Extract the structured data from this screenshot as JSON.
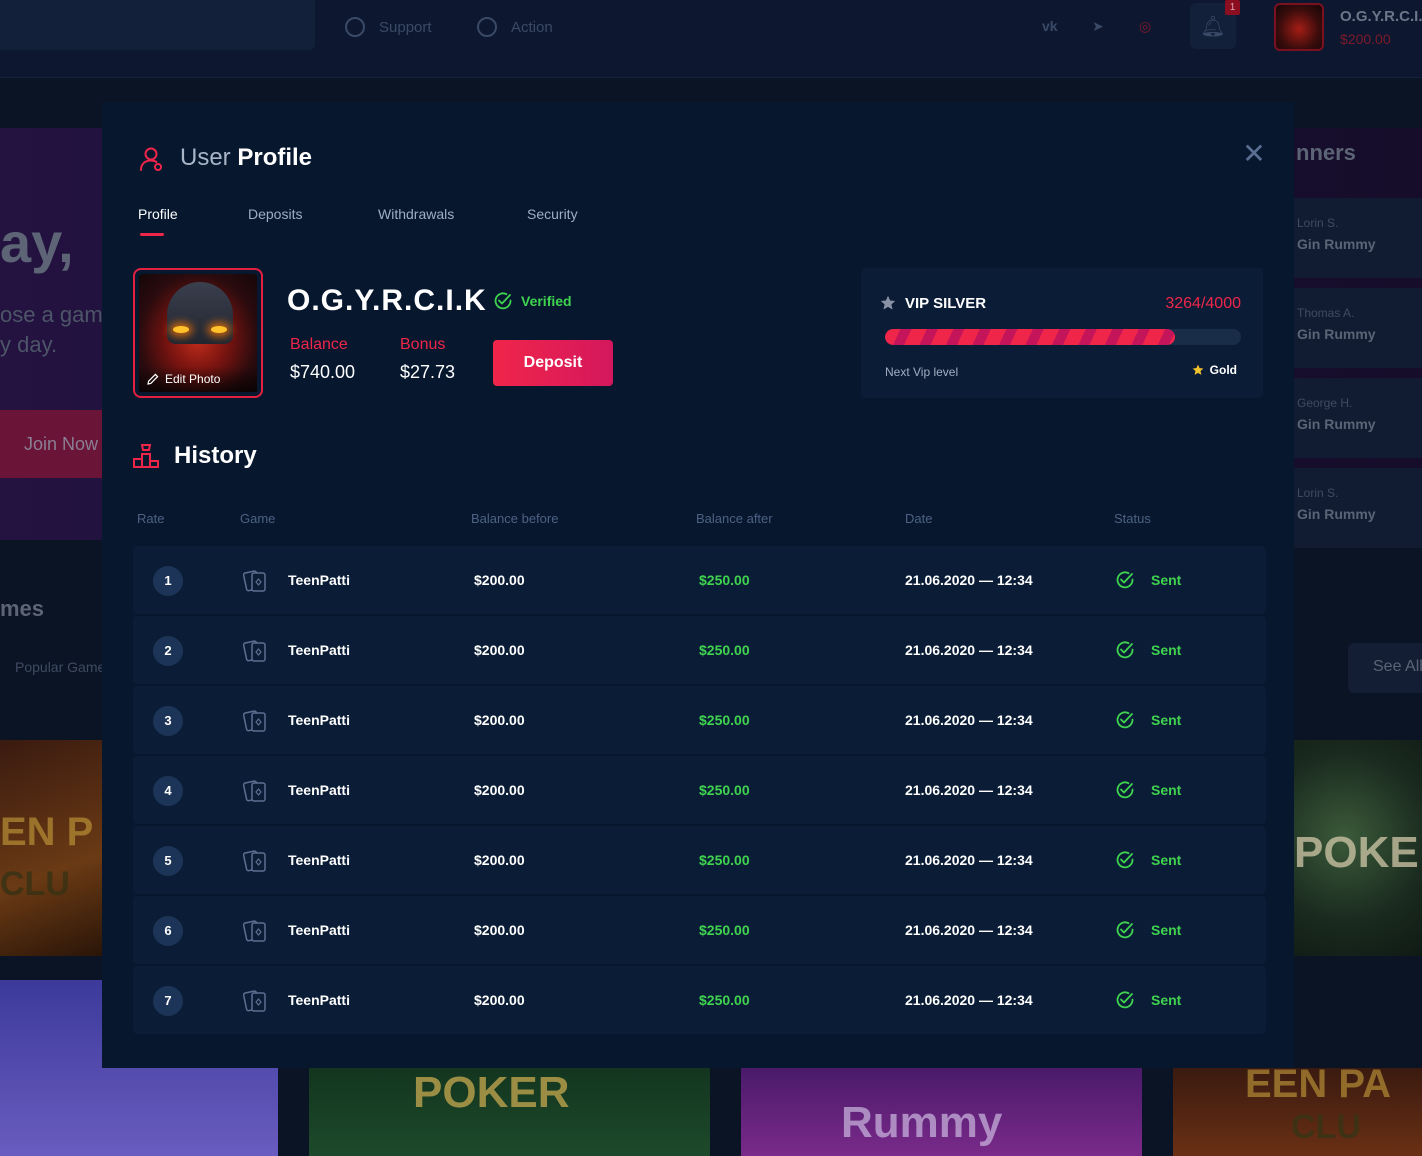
{
  "background": {
    "nav": {
      "support_label": "Support",
      "action_label": "Action",
      "social": [
        {
          "icon": "vk-icon",
          "glyph": "vk",
          "color": "#3a4966"
        },
        {
          "icon": "telegram-icon",
          "glyph": "➤",
          "color": "#3a4966"
        },
        {
          "icon": "instagram-icon",
          "glyph": "◎",
          "color": "#7e1a2a"
        }
      ],
      "notification_count": "1",
      "username": "O.G.Y.R.C.I.K",
      "balance": "$200.00"
    },
    "hero": {
      "title_fragment": "ay, ",
      "subtitle_line1": "ose a gam",
      "subtitle_line2": "y day.",
      "join_label": "Join Now"
    },
    "winners": {
      "title_fragment": "nners",
      "items": [
        {
          "name": "Lorin S.",
          "game": "Gin Rummy"
        },
        {
          "name": "Thomas A.",
          "game": "Gin Rummy"
        },
        {
          "name": "George H.",
          "game": "Gin Rummy"
        },
        {
          "name": "Lorin S.",
          "game": "Gin Rummy"
        }
      ]
    },
    "games": {
      "title_fragment": "mes",
      "filter_fragment": "Popular Game",
      "see_all_label": "See All",
      "tiles": [
        "EN P",
        "CLU",
        "POKE",
        "POKER",
        "Rummy",
        "EEN PA",
        "CLU"
      ]
    }
  },
  "modal": {
    "title_light": "User ",
    "title_bold": "Profile",
    "tabs": [
      {
        "label": "Profile",
        "active": true
      },
      {
        "label": "Deposits",
        "active": false
      },
      {
        "label": "Withdrawals",
        "active": false
      },
      {
        "label": "Security",
        "active": false
      }
    ],
    "profile": {
      "edit_photo_label": "Edit Photo",
      "username": "O.G.Y.R.C.I.K",
      "verified_label": "Verified",
      "balance_label": "Balance",
      "balance_value": "$740.00",
      "bonus_label": "Bonus",
      "bonus_value": "$27.73",
      "deposit_label": "Deposit"
    },
    "vip": {
      "title": "VIP SILVER",
      "score_text": "3264/4000",
      "progress_current": 3264,
      "progress_max": 4000,
      "next_label": "Next Vip level",
      "next_level": "Gold"
    },
    "history": {
      "title": "History",
      "columns": [
        "Rate",
        "Game",
        "Balance before",
        "Balance after",
        "Date",
        "Status"
      ],
      "rows": [
        {
          "rate": "1",
          "game": "TeenPatti",
          "before": "$200.00",
          "after": "$250.00",
          "date": "21.06.2020 — 12:34",
          "status": "Sent"
        },
        {
          "rate": "2",
          "game": "TeenPatti",
          "before": "$200.00",
          "after": "$250.00",
          "date": "21.06.2020 — 12:34",
          "status": "Sent"
        },
        {
          "rate": "3",
          "game": "TeenPatti",
          "before": "$200.00",
          "after": "$250.00",
          "date": "21.06.2020 — 12:34",
          "status": "Sent"
        },
        {
          "rate": "4",
          "game": "TeenPatti",
          "before": "$200.00",
          "after": "$250.00",
          "date": "21.06.2020 — 12:34",
          "status": "Sent"
        },
        {
          "rate": "5",
          "game": "TeenPatti",
          "before": "$200.00",
          "after": "$250.00",
          "date": "21.06.2020 — 12:34",
          "status": "Sent"
        },
        {
          "rate": "6",
          "game": "TeenPatti",
          "before": "$200.00",
          "after": "$250.00",
          "date": "21.06.2020 — 12:34",
          "status": "Sent"
        },
        {
          "rate": "7",
          "game": "TeenPatti",
          "before": "$200.00",
          "after": "$250.00",
          "date": "21.06.2020 — 12:34",
          "status": "Sent"
        }
      ]
    }
  },
  "colors": {
    "accent": "#f0254a",
    "success": "#3fd34f",
    "modal_bg": "#06172e",
    "row_bg": "#0b1d36"
  }
}
